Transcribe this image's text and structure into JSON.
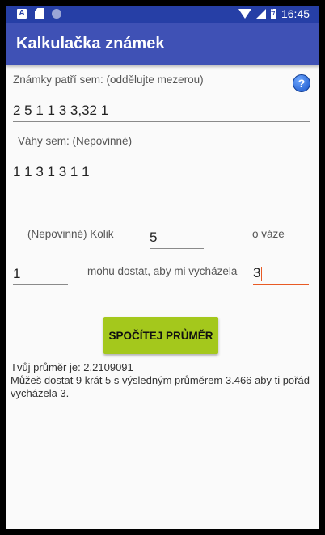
{
  "status_bar": {
    "time": "16:45",
    "icons": [
      "notification-a-icon",
      "sd-card-icon",
      "circle-icon",
      "wifi-icon",
      "signal-icon",
      "battery-charging-icon"
    ]
  },
  "app_bar": {
    "title": "Kalkulačka známek"
  },
  "grades": {
    "label": "Známky patří sem: (oddělujte mezerou)",
    "value": "2 5 1 1 3 3,32 1"
  },
  "weights": {
    "label": "Váhy sem: (Nepovinné)",
    "value": "1 1 3 1 3 1 1"
  },
  "optional": {
    "label_how_many": "(Nepovinné) Kolik",
    "grade_value": "5",
    "label_weight": "o váze",
    "weight_value": "1",
    "label_can_get": "mohu dostat, aby mi vycházela",
    "target_value": "3"
  },
  "calculate_button": {
    "label": "SPOČÍTEJ PRŮMĚR"
  },
  "result": {
    "average": "Tvůj průměr je: 2.2109091",
    "message": "Můžeš dostat 9 krát 5 s výsledným průměrem 3.466 aby ti pořád vycházela 3."
  },
  "colors": {
    "status_bar": "#263fa6",
    "app_bar": "#3f51b5",
    "button": "#a4c81c",
    "accent": "#e85a24"
  }
}
